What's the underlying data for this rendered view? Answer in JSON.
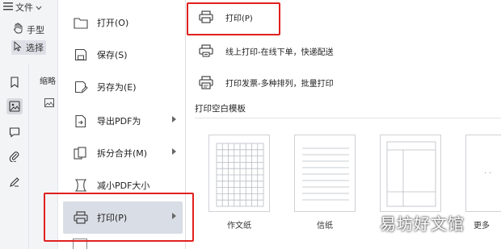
{
  "toolbar": {
    "file_label": "文件",
    "hand_label": "手型",
    "select_label": "选择",
    "thumbnail_label": "缩略"
  },
  "menu": {
    "items": [
      {
        "label": "打开(O)",
        "icon": "folder-icon",
        "has_submenu": false
      },
      {
        "label": "保存(S)",
        "icon": "save-icon",
        "has_submenu": false
      },
      {
        "label": "另存为(E)",
        "icon": "save-as-icon",
        "has_submenu": false
      },
      {
        "label": "导出PDF为",
        "icon": "export-pdf-icon",
        "has_submenu": true
      },
      {
        "label": "拆分合并(M)",
        "icon": "split-merge-icon",
        "has_submenu": true
      },
      {
        "label": "减小PDF大小",
        "icon": "compress-icon",
        "has_submenu": false
      },
      {
        "label": "打印(P)",
        "icon": "printer-icon",
        "has_submenu": true,
        "active": true
      }
    ]
  },
  "submenu": {
    "print_label": "打印(P)",
    "online_print_label": "线上打印-在线下单，快递配送",
    "invoice_print_label": "打印发票-多种排列，批量打印",
    "blank_template_heading": "打印空白模板",
    "templates": [
      {
        "label": "作文纸"
      },
      {
        "label": "信纸"
      },
      {
        "label": ""
      },
      {
        "label": "更多"
      }
    ]
  },
  "watermark": "易坊好文馆",
  "colors": {
    "highlight_border": "#e0201e",
    "active_item_bg": "#d9dde5",
    "sidebar_bg": "#f3f4f6"
  }
}
